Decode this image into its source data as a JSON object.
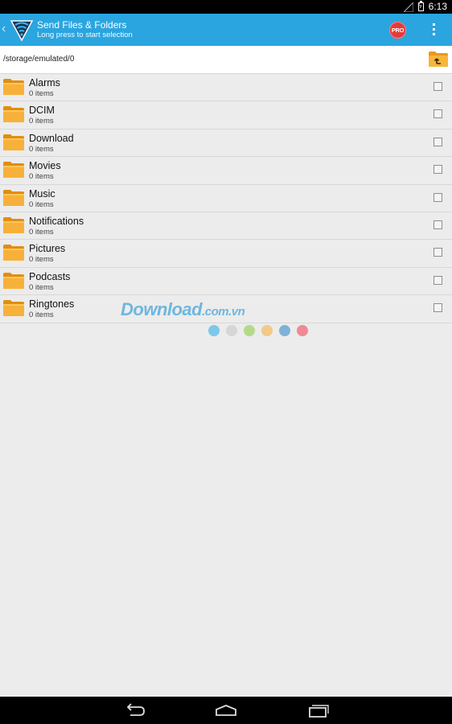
{
  "status_bar": {
    "time": "6:13"
  },
  "action_bar": {
    "title": "Send Files & Folders",
    "subtitle": "Long press to start selection",
    "pro_badge": "PRO"
  },
  "path_bar": {
    "path": "/storage/emulated/0"
  },
  "folders": [
    {
      "name": "Alarms",
      "count": "0 items"
    },
    {
      "name": "DCIM",
      "count": "0 items"
    },
    {
      "name": "Download",
      "count": "0 items"
    },
    {
      "name": "Movies",
      "count": "0 items"
    },
    {
      "name": "Music",
      "count": "0 items"
    },
    {
      "name": "Notifications",
      "count": "0 items"
    },
    {
      "name": "Pictures",
      "count": "0 items"
    },
    {
      "name": "Podcasts",
      "count": "0 items"
    },
    {
      "name": "Ringtones",
      "count": "0 items"
    }
  ],
  "watermark": {
    "main": "Download",
    "suffix": ".com.vn"
  },
  "colors": {
    "action_bar": "#2aa5e0",
    "pro_badge": "#e63a3a",
    "folder": "#f4a623",
    "watermark_dots": [
      "#7cc8ea",
      "#d6d6d6",
      "#b5d98a",
      "#f3c98a",
      "#7fb2d8",
      "#ee8a93"
    ]
  },
  "icons": {
    "app_logo": "wifi-shield-icon",
    "up_folder": "folder-up-icon",
    "overflow": "overflow-menu-icon",
    "nav": [
      "back-icon",
      "home-icon",
      "recent-apps-icon"
    ]
  }
}
